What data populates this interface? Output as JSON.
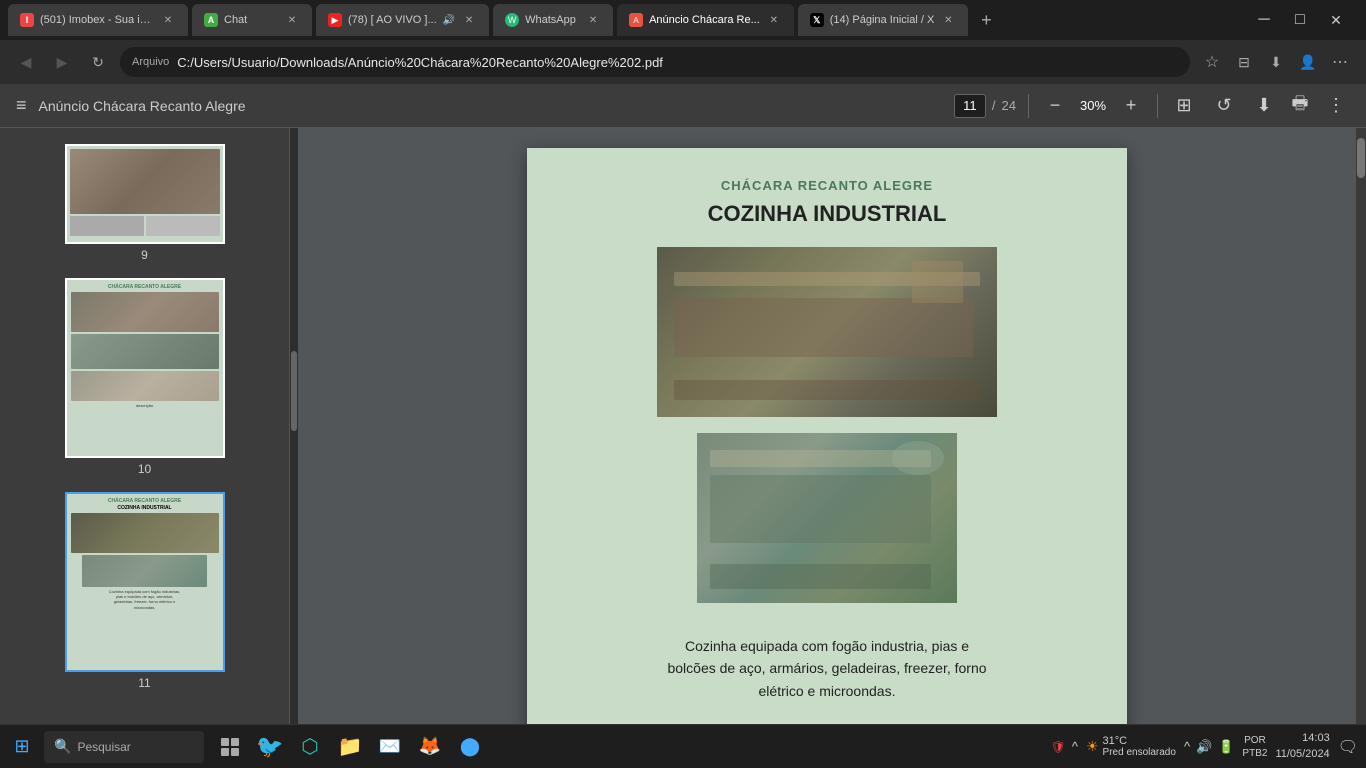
{
  "browser": {
    "tabs": [
      {
        "id": "tab1",
        "favicon_type": "fav-imobex",
        "favicon_text": "I",
        "title": "(501) Imobex - Sua in...",
        "active": false,
        "audio": false
      },
      {
        "id": "tab2",
        "favicon_type": "fav-chat",
        "favicon_text": "A",
        "title": "Chat",
        "active": false,
        "audio": false
      },
      {
        "id": "tab3",
        "favicon_type": "fav-youtube",
        "favicon_text": "▶",
        "title": "(78) [ AO VIVO ]...",
        "active": false,
        "audio": true
      },
      {
        "id": "tab4",
        "favicon_type": "fav-whatsapp",
        "favicon_text": "W",
        "title": "WhatsApp",
        "active": false,
        "audio": false
      },
      {
        "id": "tab5",
        "favicon_type": "fav-pdf",
        "favicon_text": "A",
        "title": "Anúncio Chácara Re...",
        "active": true,
        "audio": false
      },
      {
        "id": "tab6",
        "favicon_type": "fav-twitter",
        "favicon_text": "X",
        "title": "(14) Página Inicial / X",
        "active": false,
        "audio": false
      }
    ],
    "address": "C:/Users/Usuario/Downloads/Anúncio%20Chácara%20Recanto%20Alegre%202.pdf",
    "address_prefix": "Arquivo"
  },
  "pdf_toolbar": {
    "menu_icon": "≡",
    "title": "Anúncio Chácara Recanto Alegre",
    "current_page": "11",
    "total_pages": "24",
    "separator": "/",
    "zoom_out": "−",
    "zoom_in": "+",
    "zoom_level": "30%",
    "layout_icon": "⊞",
    "rotate_icon": "↺",
    "download_icon": "⬇",
    "print_icon": "🖶",
    "more_icon": "⋮"
  },
  "thumbnails": [
    {
      "number": "9",
      "active": false
    },
    {
      "number": "10",
      "active": false
    },
    {
      "number": "11",
      "active": true
    }
  ],
  "pdf_page": {
    "header": "CHÁCARA RECANTO ALEGRE",
    "title": "COZINHA INDUSTRIAL",
    "description": "Cozinha equipada com fogão industria, pias e bolcões de aço, armários, geladeiras, freezer, forno elétrico e microondas."
  },
  "taskbar": {
    "search_placeholder": "Pesquisar",
    "temp": "31°C",
    "weather_desc": "Pred ensolarado",
    "language": "POR\nPTB2",
    "time": "14:03",
    "date": "11/05/2024",
    "start_icon": "⊞"
  }
}
